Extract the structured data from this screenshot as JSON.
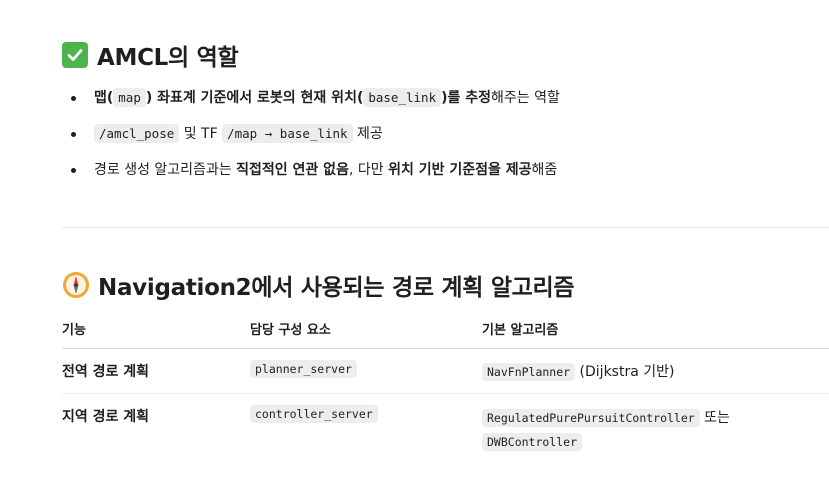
{
  "section1": {
    "icon": "check-mark-icon",
    "title": "AMCL의 역할",
    "bullets": [
      {
        "p1": "맵(",
        "c1": "map",
        "p2": ") 좌표계 기준에서 로봇의 현재 위치(",
        "c2": "base_link",
        "p3": ")를 추정",
        "p4": "해주는 역할"
      },
      {
        "c1": "/amcl_pose",
        "p1": " 및 TF ",
        "c2": "/map → base_link",
        "p2": " 제공"
      },
      {
        "p1": "경로 생성 알고리즘과는 ",
        "b1": "직접적인 연관 없음",
        "p2": ", 다만 ",
        "b2": "위치 기반 기준점을 제공",
        "p3": "해줌"
      }
    ]
  },
  "section2": {
    "icon": "compass-icon",
    "title": "Navigation2에서 사용되는 경로 계획 알고리즘",
    "table": {
      "headers": [
        "기능",
        "담당 구성 요소",
        "기본 알고리즘"
      ],
      "rows": [
        {
          "function": "전역 경로 계획",
          "component": "planner_server",
          "algo_code": "NavFnPlanner",
          "algo_text": " (Dijkstra 기반)"
        },
        {
          "function": "지역 경로 계획",
          "component": "controller_server",
          "algo_code": "RegulatedPurePursuitController",
          "algo_text": " 또는",
          "algo_code2": "DWBController"
        }
      ]
    }
  },
  "colors": {
    "check_green": "#4fb34b",
    "code_bg": "#ededed"
  }
}
